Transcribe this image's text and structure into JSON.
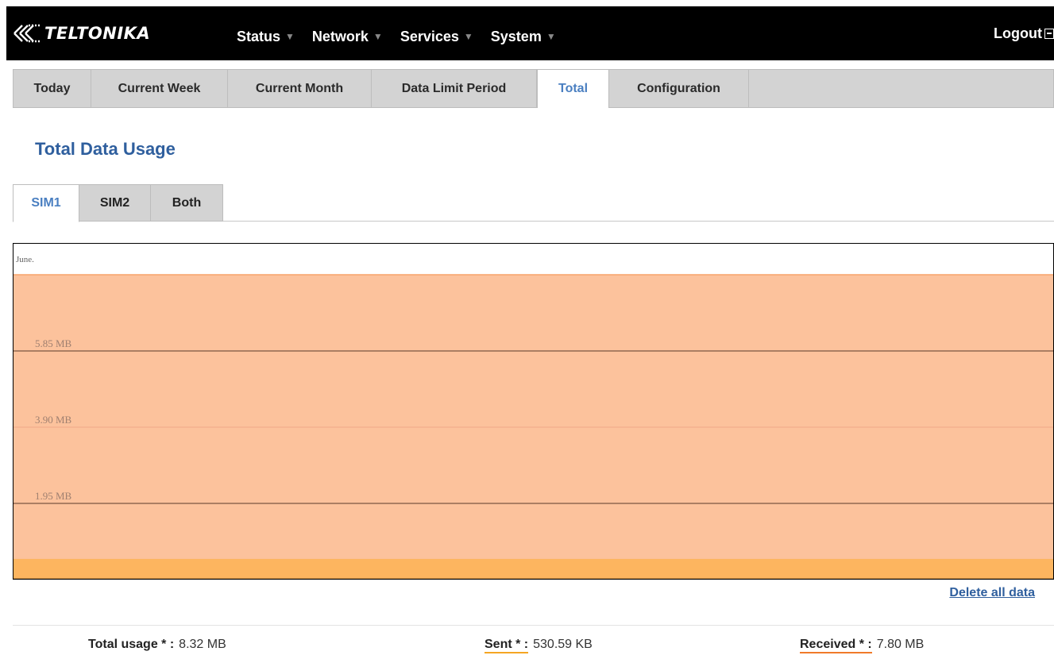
{
  "header": {
    "logo_text": "TELTONIKA",
    "nav": [
      {
        "label": "Status"
      },
      {
        "label": "Network"
      },
      {
        "label": "Services"
      },
      {
        "label": "System"
      }
    ],
    "logout_label": "Logout"
  },
  "tabs": [
    {
      "label": "Today"
    },
    {
      "label": "Current Week"
    },
    {
      "label": "Current Month"
    },
    {
      "label": "Data Limit Period"
    },
    {
      "label": "Total",
      "active": true
    },
    {
      "label": "Configuration"
    }
  ],
  "page_title": "Total Data Usage",
  "sim_tabs": [
    {
      "label": "SIM1",
      "active": true
    },
    {
      "label": "SIM2"
    },
    {
      "label": "Both"
    }
  ],
  "chart_data": {
    "type": "area",
    "period_label": "June.",
    "y_tick_labels": [
      "5.85 MB",
      "3.90 MB",
      "1.95 MB"
    ],
    "y_ticks_mb": [
      5.85,
      3.9,
      1.95
    ],
    "ylim_mb": [
      0,
      7.8
    ],
    "series": [
      {
        "name": "Received",
        "value_mb": 7.8,
        "color": "#fcc29c"
      },
      {
        "name": "Sent",
        "value_mb": 0.53,
        "color": "#fdb55f"
      }
    ],
    "grid": true
  },
  "delete_label": "Delete all data",
  "stats": {
    "total_label": "Total usage * :",
    "total_value": "8.32 MB",
    "sent_label": "Sent * :",
    "sent_value": "530.59 KB",
    "received_label": "Received * :",
    "received_value": "7.80 MB"
  },
  "colors": {
    "accent": "#2f5f9e",
    "active_tab_text": "#4a7fc1",
    "received_area": "#fcc29c",
    "sent_area": "#fdb55f"
  }
}
